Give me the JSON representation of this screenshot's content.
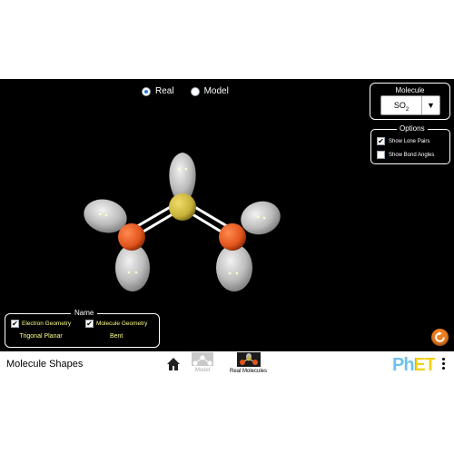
{
  "mode": {
    "options": [
      {
        "label": "Real",
        "selected": true
      },
      {
        "label": "Model",
        "selected": false
      }
    ]
  },
  "molecule_panel": {
    "title": "Molecule",
    "selected_formula": "SO",
    "selected_subscript": "2",
    "dropdown_arrow": "▼"
  },
  "options_panel": {
    "title": "Options",
    "show_lone_pairs": {
      "label": "Show Lone Pairs",
      "checked": true
    },
    "show_bond_angles": {
      "label": "Show Bond Angles",
      "checked": false
    }
  },
  "name_panel": {
    "title": "Name",
    "electron_geometry": {
      "label": "Electron Geometry",
      "checked": true,
      "value": "Trigonal Planar"
    },
    "molecule_geometry": {
      "label": "Molecule Geometry",
      "checked": true,
      "value": "Bent"
    }
  },
  "navbar": {
    "sim_title": "Molecule Shapes",
    "screens": [
      {
        "label": "Model",
        "selected": false
      },
      {
        "label": "Real Molecules",
        "selected": true
      }
    ],
    "logo_text": "PhET"
  },
  "colors": {
    "sulfur": "#c8b23a",
    "oxygen": "#e0541c",
    "lone_pair": "#c8c8c8",
    "accent_yellow": "#ffff8a",
    "reset_orange": "#ee7d1f",
    "phet_blue": "#6cc3e8",
    "phet_yellow": "#f2d21b"
  },
  "icons": [
    "home-icon",
    "reset-icon",
    "checkmark-icon",
    "chevron-down-icon",
    "menu-icon"
  ]
}
